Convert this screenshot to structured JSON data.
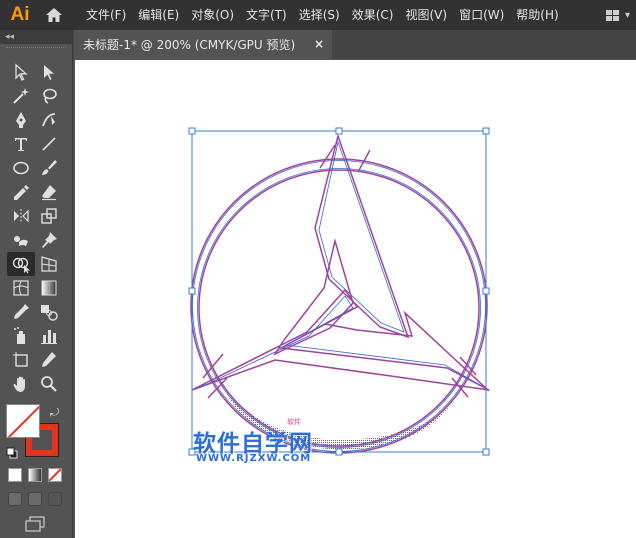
{
  "app": {
    "logo": "Ai",
    "menus": [
      "文件(F)",
      "编辑(E)",
      "对象(O)",
      "文字(T)",
      "选择(S)",
      "效果(C)",
      "视图(V)",
      "窗口(W)",
      "帮助(H)"
    ]
  },
  "tools_panel": {
    "collapse_label": "◂◂"
  },
  "document": {
    "tab_title": "未标题-1* @ 200% (CMYK/GPU 预览)",
    "close": "×"
  },
  "watermark": {
    "chinese": "软件自学网",
    "url": "WWW.RJZXW.COM",
    "tag": "软件"
  },
  "colors": {
    "accent": "#ff9a00",
    "stroke_outer": "#a0449a",
    "stroke_inner": "#3a62d6",
    "stroke_swatch": "#e0351f",
    "selection": "#3a7bd5"
  }
}
